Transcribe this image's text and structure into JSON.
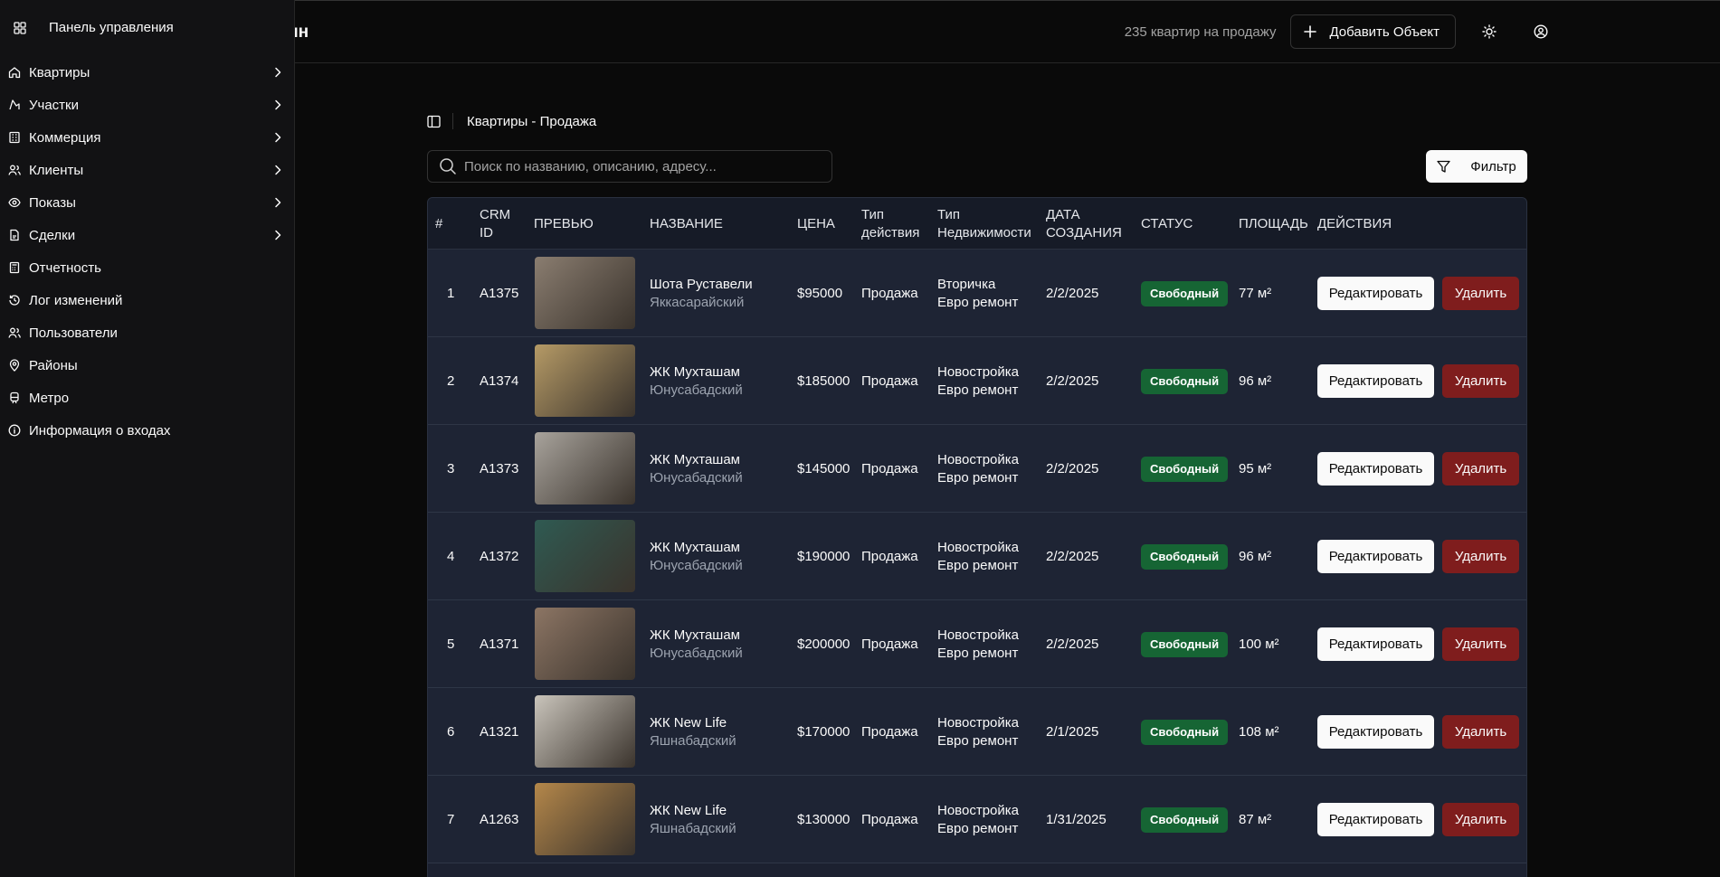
{
  "header": {
    "logo_fragment": "ин",
    "count_text": "235 квартир на продажу",
    "add_label": "Добавить Объект"
  },
  "sidebar": {
    "dashboard_label": "Панель управления",
    "items": [
      {
        "label": "Квартиры",
        "icon": "home-icon",
        "has_children": true
      },
      {
        "label": "Участки",
        "icon": "map-pin-icon",
        "has_children": true
      },
      {
        "label": "Коммерция",
        "icon": "building-icon",
        "has_children": true
      },
      {
        "label": "Клиенты",
        "icon": "users-icon",
        "has_children": true
      },
      {
        "label": "Показы",
        "icon": "eye-icon",
        "has_children": true
      },
      {
        "label": "Сделки",
        "icon": "file-icon",
        "has_children": true
      },
      {
        "label": "Отчетность",
        "icon": "calculator-icon",
        "has_children": false
      },
      {
        "label": "Лог изменений",
        "icon": "history-icon",
        "has_children": false
      },
      {
        "label": "Пользователи",
        "icon": "users-icon",
        "has_children": false
      },
      {
        "label": "Районы",
        "icon": "location-icon",
        "has_children": false
      },
      {
        "label": "Метро",
        "icon": "train-icon",
        "has_children": false
      },
      {
        "label": "Информация о входах",
        "icon": "info-icon",
        "has_children": false
      }
    ]
  },
  "breadcrumb": {
    "title": "Квартиры - Продажа"
  },
  "search": {
    "placeholder": "Поиск по названию, описанию, адресу..."
  },
  "filter_label": "Фильтр",
  "table": {
    "columns": {
      "num": "#",
      "crm1": "CRM",
      "crm2": "ID",
      "preview": "ПРЕВЬЮ",
      "name": "НАЗВАНИЕ",
      "price": "ЦЕНА",
      "deal1": "Тип",
      "deal2": "действия",
      "ptype1": "Тип",
      "ptype2": "Недвижимости",
      "date1": "ДАТА",
      "date2": "СОЗДАНИЯ",
      "status": "СТАТУС",
      "area": "ПЛОЩАДЬ",
      "actions": "ДЕЙСТВИЯ"
    },
    "edit_label": "Редактировать",
    "delete_label": "Удалить",
    "rows": [
      {
        "num": "1",
        "crm": "A1375",
        "name": "Шота Руставели",
        "district": "Яккасарайский",
        "price": "$95000",
        "deal": "Продажа",
        "ptype": "Вторичка",
        "repair": "Евро ремонт",
        "date": "2/2/2025",
        "status": "Свободный",
        "area": "77 м²",
        "thumb": "#8a7d70"
      },
      {
        "num": "2",
        "crm": "A1374",
        "name": "ЖК Мухташам",
        "district": "Юнусабадский",
        "price": "$185000",
        "deal": "Продажа",
        "ptype": "Новостройка",
        "repair": "Евро ремонт",
        "date": "2/2/2025",
        "status": "Свободный",
        "area": "96 м²",
        "thumb": "#b59a66"
      },
      {
        "num": "3",
        "crm": "A1373",
        "name": "ЖК Мухташам",
        "district": "Юнусабадский",
        "price": "$145000",
        "deal": "Продажа",
        "ptype": "Новостройка",
        "repair": "Евро ремонт",
        "date": "2/2/2025",
        "status": "Свободный",
        "area": "95 м²",
        "thumb": "#a8a39c"
      },
      {
        "num": "4",
        "crm": "A1372",
        "name": "ЖК Мухташам",
        "district": "Юнусабадский",
        "price": "$190000",
        "deal": "Продажа",
        "ptype": "Новостройка",
        "repair": "Евро ремонт",
        "date": "2/2/2025",
        "status": "Свободный",
        "area": "96 м²",
        "thumb": "#2f5a52"
      },
      {
        "num": "5",
        "crm": "A1371",
        "name": "ЖК Мухташам",
        "district": "Юнусабадский",
        "price": "$200000",
        "deal": "Продажа",
        "ptype": "Новостройка",
        "repair": "Евро ремонт",
        "date": "2/2/2025",
        "status": "Свободный",
        "area": "100 м²",
        "thumb": "#8c7564"
      },
      {
        "num": "6",
        "crm": "A1321",
        "name": "ЖК New Life",
        "district": "Яшнабадский",
        "price": "$170000",
        "deal": "Продажа",
        "ptype": "Новостройка",
        "repair": "Евро ремонт",
        "date": "2/1/2025",
        "status": "Свободный",
        "area": "108 м²",
        "thumb": "#c9c4bb"
      },
      {
        "num": "7",
        "crm": "A1263",
        "name": "ЖК New Life",
        "district": "Яшнабадский",
        "price": "$130000",
        "deal": "Продажа",
        "ptype": "Новостройка",
        "repair": "Евро ремонт",
        "date": "1/31/2025",
        "status": "Свободный",
        "area": "87 м²",
        "thumb": "#b4874a"
      }
    ]
  }
}
